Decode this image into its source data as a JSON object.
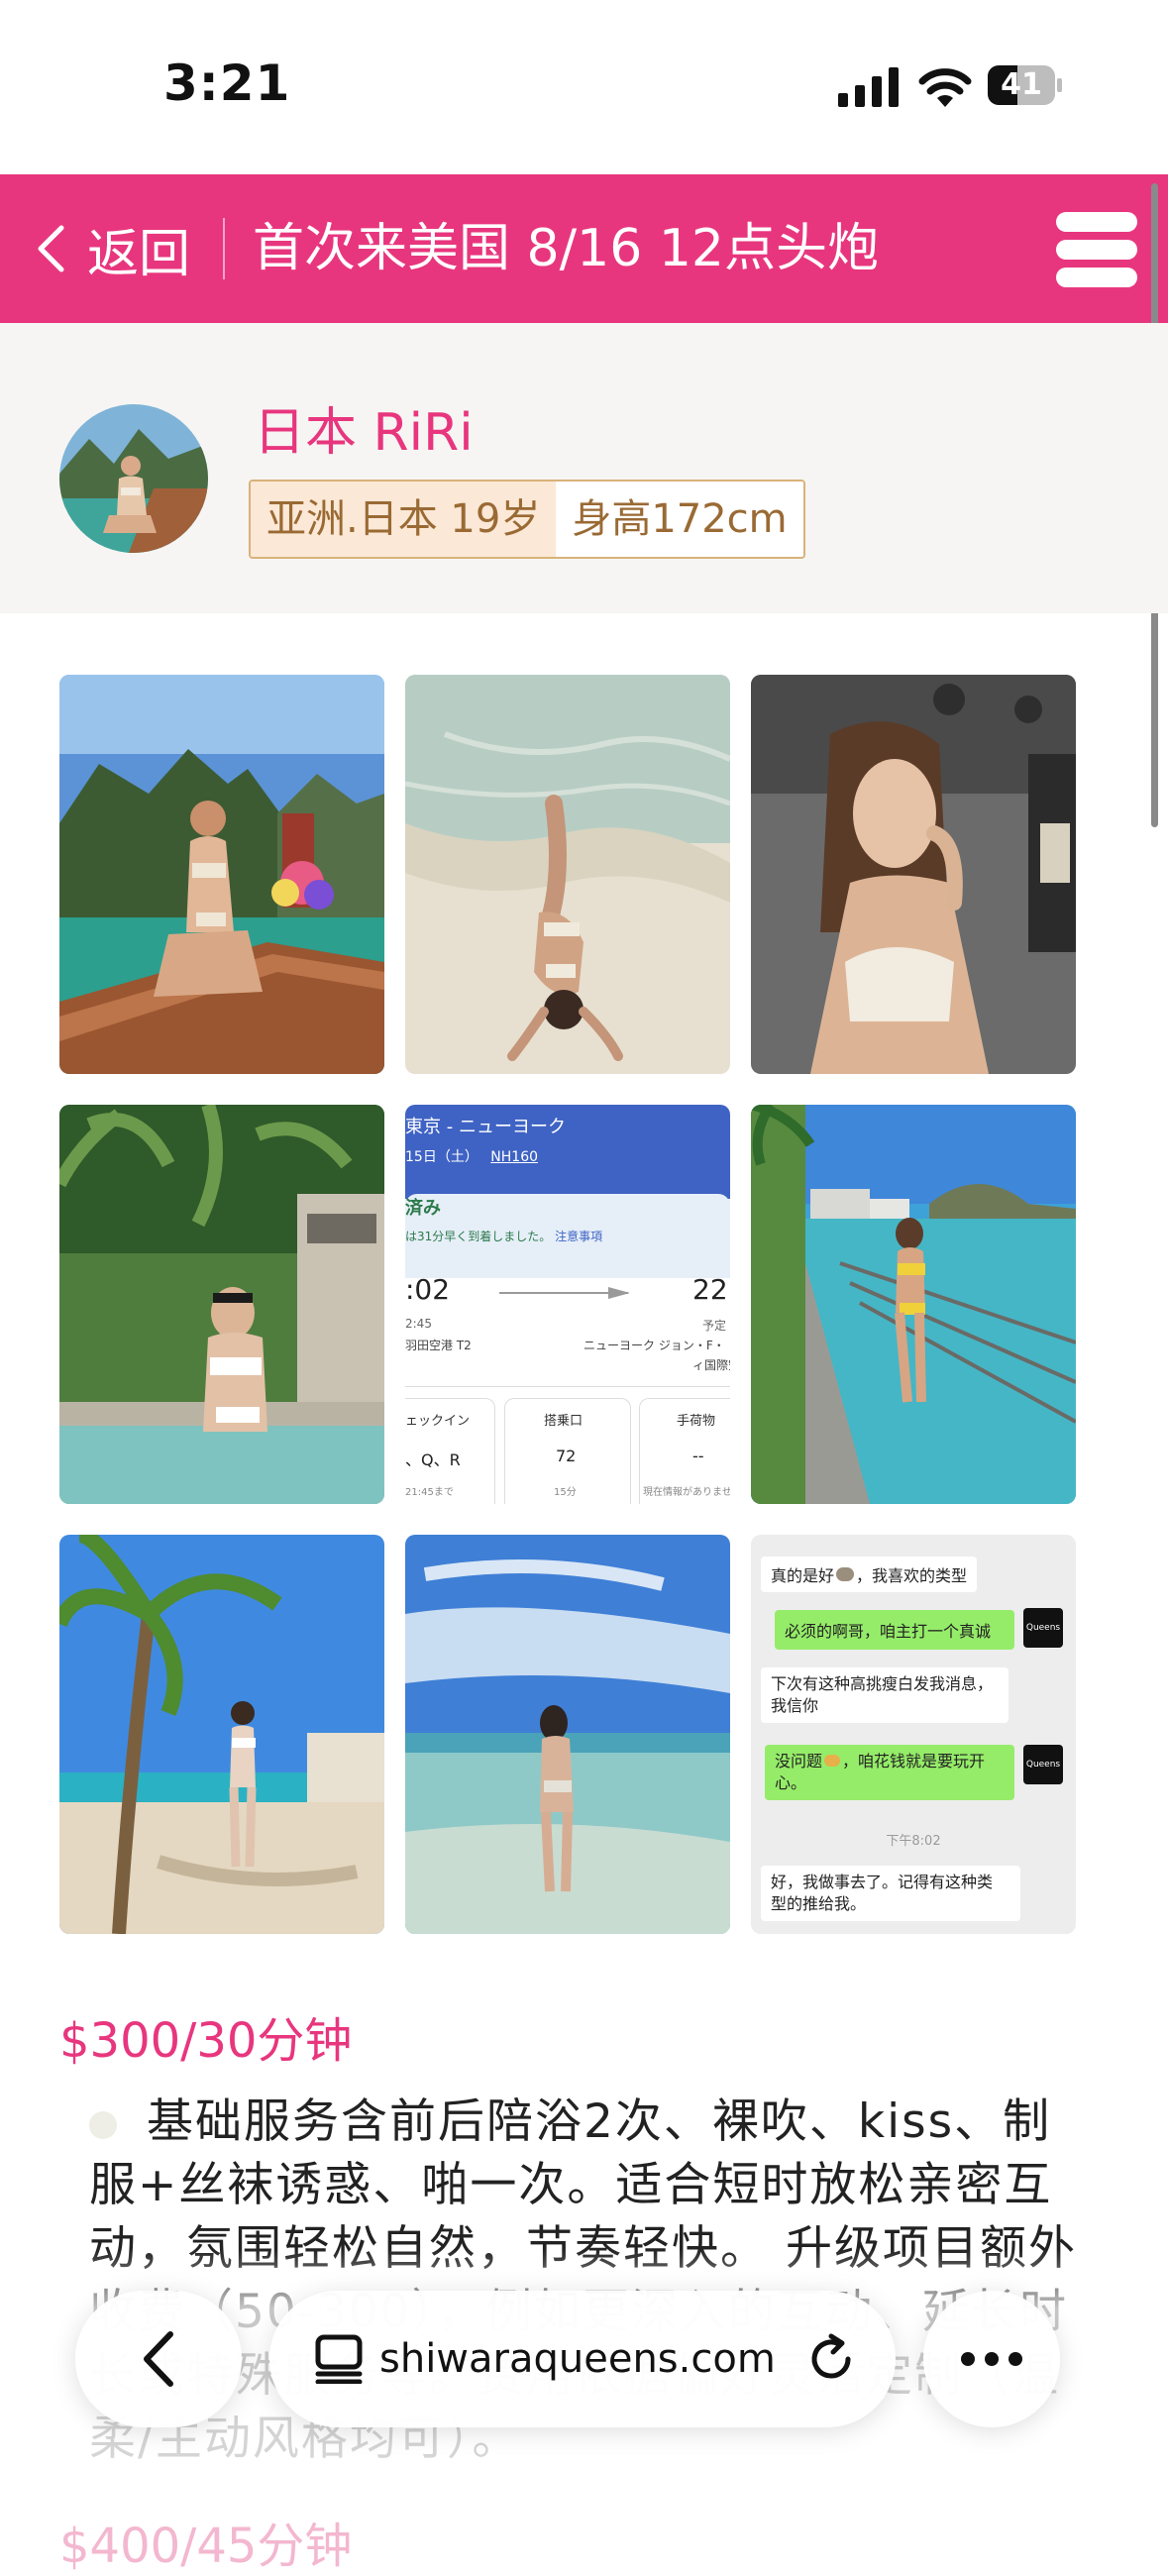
{
  "status_bar": {
    "time": "3:21",
    "battery_level": "41"
  },
  "header": {
    "back_label": "返回",
    "title": "首次来美国 8/16 12点头炮",
    "accent_color": "#e8367e"
  },
  "profile": {
    "name": "日本 RiRi",
    "region_age": "亚洲.日本 19岁",
    "height": "身高172cm"
  },
  "gallery": {
    "flight_card": {
      "route": "東京 - ニューヨーク",
      "date": "15日（土）",
      "flight_no": "NH160",
      "status": "済み",
      "note": "は31分早く到着しました。",
      "note_link": "注意事項",
      "dep_time": ":02",
      "arr_time": "22:",
      "dep_sched": "2:45",
      "arr_sched": "予定",
      "dep_airport": "羽田空港 T2",
      "arr_airport": "ニューヨーク ジョン・F・",
      "arr_airport2": "ィ国際空",
      "col1_label": "ェックイン",
      "col1_value": "、Q、R",
      "col1_sub": "21:45まで",
      "col2_label": "搭乗口",
      "col2_value": "72",
      "col2_sub": "15分",
      "col3_label": "手荷物",
      "col3_value": "--",
      "col3_sub": "現在情報がありませ"
    },
    "chat": {
      "m1": "真的是好",
      "m1b": "，我喜欢的类型",
      "m2": "必须的啊哥，咱主打一个真诚",
      "m3": "下次有这种高挑瘦白发我消息，",
      "m3b": "我信你",
      "m4": "没问题",
      "m4b": "，咱花钱就是要玩开",
      "m4c": "心。",
      "time": "下午8:02",
      "m5": "好，我做事去了。记得有这种类",
      "m5b": "型的推给我。",
      "logo": "Queens"
    }
  },
  "pricing": {
    "price": "$300/30分钟",
    "description": "基础服务含前后陪浴2次、裸吹、kiss、制服+丝袜诱惑、啪一次。适合短时放松亲密互动，氛围轻松自然，节奏轻快。 升级项目额外收费（50-300），例如更深入的互动、延长时长或特殊服务等。费用依据偏好灵活定制（温柔/主动风格均可）。",
    "next_price": "$400/45分钟"
  },
  "browser": {
    "url": "shiwaraqueens.com"
  }
}
